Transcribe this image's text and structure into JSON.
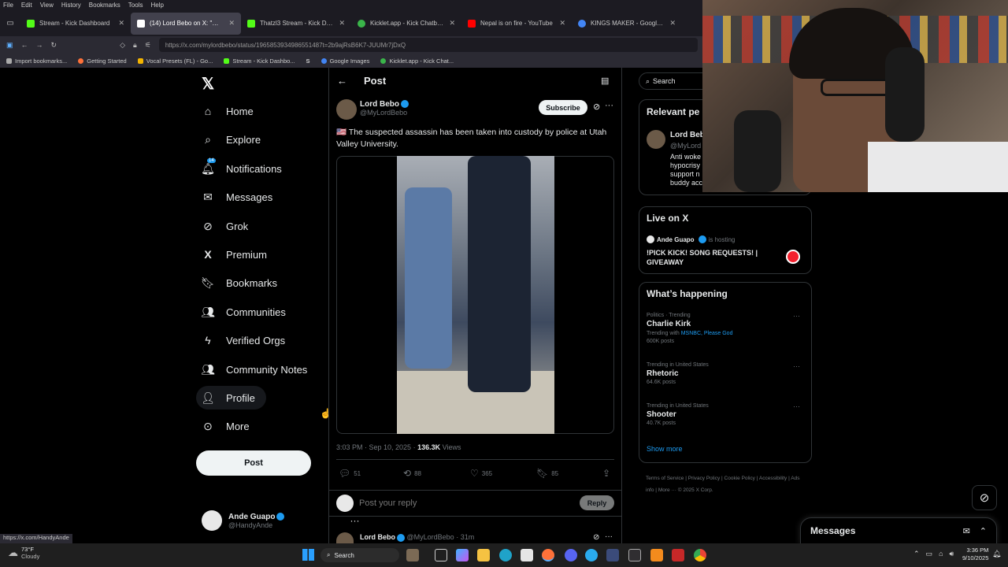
{
  "browser": {
    "menu": [
      "File",
      "Edit",
      "View",
      "History",
      "Bookmarks",
      "Tools",
      "Help"
    ],
    "tabs": [
      {
        "label": "Stream - Kick Dashboard",
        "color": "#53fc18"
      },
      {
        "label": "(14) Lord Bebo on X: \"🇺🇸 Th",
        "color": "#ffffff",
        "active": true
      },
      {
        "label": "Thatzl3 Stream - Kick Dash",
        "color": "#53fc18"
      },
      {
        "label": "Kicklet.app - Kick Chatbot a",
        "color": "#3ab54a"
      },
      {
        "label": "Nepal is on fire - YouTube",
        "color": "#ff0000"
      },
      {
        "label": "KINGS MAKER - Google Search",
        "color": "#4285f4"
      }
    ],
    "url": "https://x.com/mylordbebo/status/1965853934986551487t=2b9ajRsB6K7-JUUMr7jDxQ",
    "bookmarks": [
      {
        "label": "Import bookmarks...",
        "color": "#aaaaaa"
      },
      {
        "label": "Getting Started",
        "color": "#ff7139"
      },
      {
        "label": "Vocal Presets (FL) - Go...",
        "color": "#f4b400"
      },
      {
        "label": "Stream - Kick Dashbo...",
        "color": "#53fc18"
      },
      {
        "label": "S",
        "color": "#cccccc"
      },
      {
        "label": "Google Images",
        "color": "#4285f4"
      },
      {
        "label": "Kicklet.app - Kick Chat...",
        "color": "#3ab54a"
      }
    ],
    "status_url": "https://x.com/HandyAnde"
  },
  "nav": {
    "items": [
      {
        "label": "Home",
        "icon": "home-icon"
      },
      {
        "label": "Explore",
        "icon": "search-icon"
      },
      {
        "label": "Notifications",
        "icon": "bell-icon",
        "badge": "14"
      },
      {
        "label": "Messages",
        "icon": "mail-icon"
      },
      {
        "label": "Grok",
        "icon": "grok-icon"
      },
      {
        "label": "Premium",
        "icon": "x-icon"
      },
      {
        "label": "Bookmarks",
        "icon": "bookmark-icon"
      },
      {
        "label": "Communities",
        "icon": "people-icon"
      },
      {
        "label": "Verified Orgs",
        "icon": "lightning-icon"
      },
      {
        "label": "Community Notes",
        "icon": "notes-icon"
      },
      {
        "label": "Profile",
        "icon": "person-icon"
      },
      {
        "label": "More",
        "icon": "more-circle-icon"
      }
    ],
    "post_label": "Post",
    "account": {
      "name": "Ande Guapo",
      "handle": "@HandyAnde"
    }
  },
  "post": {
    "header_title": "Post",
    "author": {
      "name": "Lord Bebo",
      "handle": "@MyLordBebo"
    },
    "subscribe_label": "Subscribe",
    "text": "🇺🇸 The suspected assassin has been taken into custody by police at Utah Valley University.",
    "timestamp": "3:03 PM · Sep 10, 2025 ·",
    "views_count": "136.3K",
    "views_label": "Views",
    "stats": {
      "replies": "51",
      "reposts": "88",
      "likes": "365",
      "bookmarks": "85"
    },
    "reply_placeholder": "Post your reply",
    "reply_button": "Reply",
    "next_reply": {
      "name": "Lord Bebo",
      "handle": "@MyLordBebo",
      "time": "· 31m"
    }
  },
  "sidebar": {
    "search_placeholder": "Search",
    "relevant": {
      "title": "Relevant pe",
      "name": "Lord Bebo",
      "handle": "@MyLord",
      "bio": [
        "Anti woke",
        "hypocrisy",
        "support n",
        "buddy acc"
      ]
    },
    "live": {
      "title": "Live on X",
      "host": "Ande Guapo",
      "host_suffix": "is hosting",
      "stream_title": "!PICK KICK! SONG REQUESTS! | GIVEAWAY"
    },
    "happening": {
      "title": "What’s happening",
      "trends": [
        {
          "meta": "Politics · Trending",
          "name": "Charlie Kirk",
          "with_prefix": "Trending with",
          "with_links": "MSNBC, Please God",
          "posts": "600K posts"
        },
        {
          "meta": "Trending in United States",
          "name": "Rhetoric",
          "posts": "64.6K posts"
        },
        {
          "meta": "Trending in United States",
          "name": "Shooter",
          "posts": "40.7K posts"
        }
      ],
      "show_more": "Show more"
    },
    "footer": [
      "Terms of Service",
      "|",
      "Privacy Policy",
      "|",
      "Cookie Policy",
      "|",
      "Accessibility",
      "|",
      "Ads info",
      "|",
      "More ···",
      "© 2025 X Corp."
    ],
    "messages_label": "Messages"
  },
  "taskbar": {
    "weather_temp": "73°F",
    "weather_desc": "Cloudy",
    "search_label": "Search",
    "time": "3:36 PM",
    "date": "9/10/2025"
  }
}
